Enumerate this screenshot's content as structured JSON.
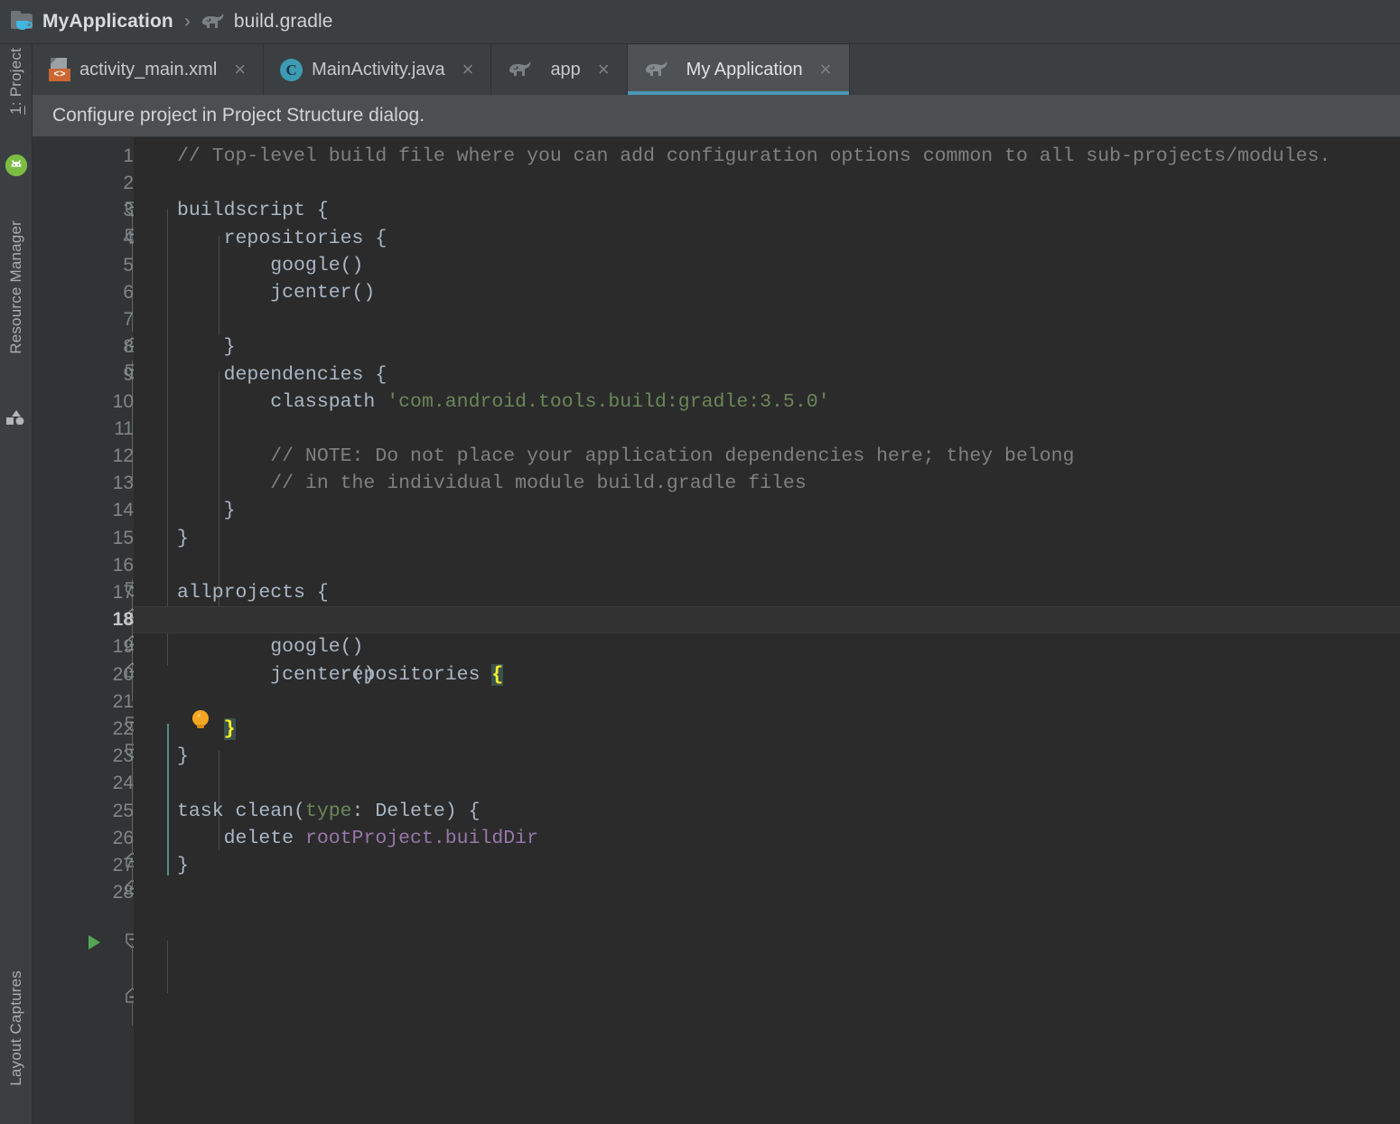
{
  "breadcrumb": {
    "module_icon": "module-folder-icon",
    "module": "MyApplication",
    "separator": "›",
    "file_icon": "gradle-elephant-icon",
    "file": "build.gradle"
  },
  "tabs": [
    {
      "id": "activity-main-xml",
      "label": "activity_main.xml",
      "icon": "xml-file-icon",
      "active": false,
      "close": "×"
    },
    {
      "id": "mainactivity-java",
      "label": "MainActivity.java",
      "icon": "java-class-icon",
      "icon_letter": "C",
      "active": false,
      "close": "×"
    },
    {
      "id": "app",
      "label": "app",
      "icon": "gradle-elephant-icon",
      "active": false,
      "close": "×"
    },
    {
      "id": "my-application",
      "label": "My Application",
      "icon": "gradle-elephant-icon",
      "active": true,
      "close": "×"
    }
  ],
  "banner": {
    "message": "Configure project in Project Structure dialog."
  },
  "sidebar": {
    "items": [
      {
        "id": "project",
        "label": "1: Project",
        "icon": ""
      },
      {
        "id": "android-logo",
        "label": "",
        "icon": "android-icon"
      },
      {
        "id": "resource-manager",
        "label": "Resource Manager",
        "icon": "shapes-icon"
      },
      {
        "id": "layout-captures",
        "label": "Layout Captures",
        "icon": ""
      }
    ]
  },
  "colors": {
    "accent_tab_underline": "#4a98b8",
    "editor_bg": "#2b2b2b",
    "gutter_bg": "#313335",
    "chrome_bg": "#3c3f41",
    "banner_bg": "#4b4f51",
    "string_green": "#6a8759",
    "comment_gray": "#808080",
    "identifier_purple": "#9876aa",
    "brace_highlight": "#ffef28",
    "run_arrow_green": "#53a653",
    "bulb_orange": "#f5a623",
    "android_green": "#7bbd42",
    "xml_badge_orange": "#cc6633",
    "class_icon_blue": "#3d9bb5"
  },
  "editor": {
    "current_line": 18,
    "total_visible_lines": 28,
    "lines": [
      {
        "n": 1,
        "text": "    // Top-level build file where you can add configuration options common to all sub-projects/modules."
      },
      {
        "n": 2,
        "text": ""
      },
      {
        "n": 3,
        "text": "buildscript {"
      },
      {
        "n": 4,
        "text": "    repositories {"
      },
      {
        "n": 5,
        "text": "        google()"
      },
      {
        "n": 6,
        "text": "        jcenter()"
      },
      {
        "n": 7,
        "text": ""
      },
      {
        "n": 8,
        "text": "    }"
      },
      {
        "n": 9,
        "text": "    dependencies {"
      },
      {
        "n": 10,
        "text": "        classpath 'com.android.tools.build:gradle:3.5.0'"
      },
      {
        "n": 11,
        "text": ""
      },
      {
        "n": 12,
        "text": "        // NOTE: Do not place your application dependencies here; they belong"
      },
      {
        "n": 13,
        "text": "        // in the individual module build.gradle files"
      },
      {
        "n": 14,
        "text": "    }"
      },
      {
        "n": 15,
        "text": "}"
      },
      {
        "n": 16,
        "text": ""
      },
      {
        "n": 17,
        "text": "allprojects {"
      },
      {
        "n": 18,
        "text": "    repositories {"
      },
      {
        "n": 19,
        "text": "        google()"
      },
      {
        "n": 20,
        "text": "        jcenter()"
      },
      {
        "n": 21,
        "text": ""
      },
      {
        "n": 22,
        "text": "    }"
      },
      {
        "n": 23,
        "text": "}"
      },
      {
        "n": 24,
        "text": ""
      },
      {
        "n": 25,
        "text": "task clean(type: Delete) {"
      },
      {
        "n": 26,
        "text": "    delete rootProject.buildDir"
      },
      {
        "n": 27,
        "text": "}"
      },
      {
        "n": 28,
        "text": ""
      }
    ],
    "string_literal": "'com.android.tools.build:gradle:3.5.0'",
    "comment_line_1": "// Top-level build file where you can add configuration options common to all sub-projects/modules.",
    "comment_note_1": "// NOTE: Do not place your application dependencies here; they belong",
    "comment_note_2": "// in the individual module build.gradle files",
    "run_arrow_line": 25,
    "bulb_line": 17
  }
}
